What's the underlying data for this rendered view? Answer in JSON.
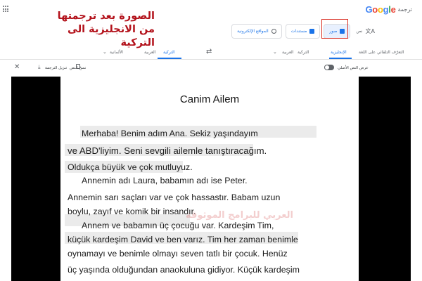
{
  "header": {
    "logo": [
      "G",
      "o",
      "o",
      "g",
      "l",
      "e"
    ],
    "logo_colors": [
      "#4285F4",
      "#EA4335",
      "#FBBC05",
      "#4285F4",
      "#34A853",
      "#EA4335"
    ],
    "product": "ترجمة"
  },
  "annotation": {
    "line1": "الصورة بعد ترجمتها",
    "line2": "من الانجليزية  الى التركية",
    "color": "#b3121b"
  },
  "modes": {
    "text": "نص",
    "images": "صور",
    "documents": "مستندات",
    "websites": "المواقع الإلكترونية"
  },
  "languages": {
    "source": [
      "التعرّف التلقائي على اللغة",
      "الإنجليزية",
      "التركية",
      "العربية"
    ],
    "target": [
      "التركية",
      "العربية",
      "الألمانية"
    ],
    "active_source": "الإنجليزية",
    "active_target": "التركية"
  },
  "toolbar": {
    "download": "تنزيل الترجمة",
    "copy": "نسخ النص",
    "show_original": "عرض النص الأصلي"
  },
  "document": {
    "title": "Canim Ailem",
    "lines": [
      "Merhaba! Benim adım Ana. Sekiz yaşındayım",
      "ve ABD'liyim. Seni sevgili ailemle tanıştıracağım.",
      "Oldukça büyük ve çok mutluyuz.",
      "Annemin adı Laura, babamın adı ise Peter.",
      "Annemin sarı saçları var ve çok hassastır. Babam uzun",
      "boylu, zayıf ve komik bir insandır.",
      "Annem ve babamın üç çocuğu var. Kardeşim Tim,",
      "küçük kardeşim David ve ben varız. Tim her zaman benimle",
      "oynamayı ve benimle olmayı seven tatlı bir çocuk. Henüz",
      "üç yaşında olduğundan anaokuluna gidiyor. Küçük kardeşim"
    ]
  },
  "watermark": "العربي للبرامج الموثوقة"
}
